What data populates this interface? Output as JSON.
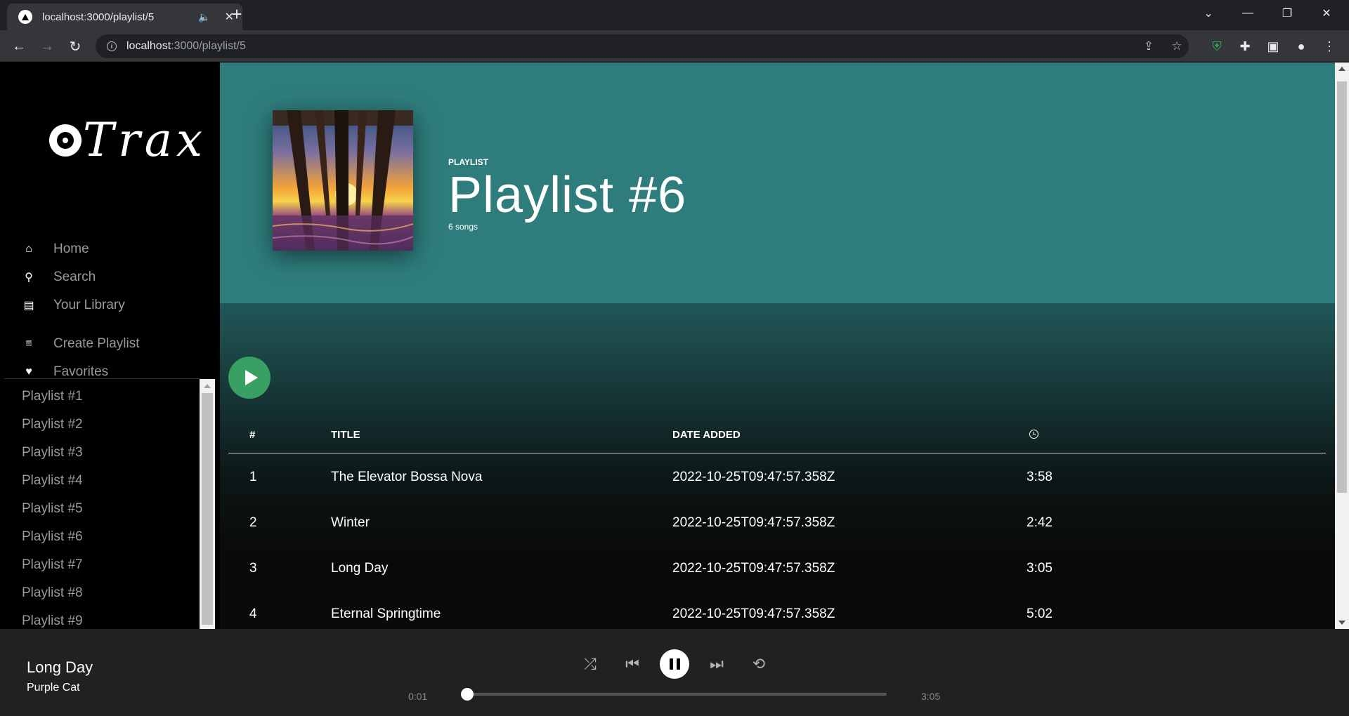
{
  "browser": {
    "tab_title": "localhost:3000/playlist/5",
    "url_host": "localhost",
    "url_path": ":3000/playlist/5"
  },
  "sidebar": {
    "logo_text": "Trax",
    "menu": [
      {
        "label": "Home",
        "icon": "home-icon"
      },
      {
        "label": "Search",
        "icon": "search-icon"
      },
      {
        "label": "Your Library",
        "icon": "library-icon"
      }
    ],
    "actions": [
      {
        "label": "Create Playlist",
        "icon": "playlist-add-icon"
      },
      {
        "label": "Favorites",
        "icon": "heart-icon"
      }
    ],
    "playlists": [
      "Playlist #1",
      "Playlist #2",
      "Playlist #3",
      "Playlist #4",
      "Playlist #5",
      "Playlist #6",
      "Playlist #7",
      "Playlist #8",
      "Playlist #9"
    ]
  },
  "header": {
    "kind": "PLAYLIST",
    "title": "Playlist #6",
    "count": "6 songs",
    "background_color": "#2e7d7c"
  },
  "table": {
    "columns": {
      "number": "#",
      "title": "TITLE",
      "date": "DATE ADDED",
      "duration_icon": "clock-icon"
    },
    "rows": [
      {
        "num": "1",
        "title": "The Elevator Bossa Nova",
        "date": "2022-10-25T09:47:57.358Z",
        "duration": "3:58"
      },
      {
        "num": "2",
        "title": "Winter",
        "date": "2022-10-25T09:47:57.358Z",
        "duration": "2:42"
      },
      {
        "num": "3",
        "title": "Long Day",
        "date": "2022-10-25T09:47:57.358Z",
        "duration": "3:05"
      },
      {
        "num": "4",
        "title": "Eternal Springtime",
        "date": "2022-10-25T09:47:57.358Z",
        "duration": "5:02"
      }
    ]
  },
  "player": {
    "song": "Long Day",
    "artist": "Purple Cat",
    "elapsed": "0:01",
    "total": "3:05",
    "progress": 0.005,
    "play_button_color": "#38a063"
  }
}
